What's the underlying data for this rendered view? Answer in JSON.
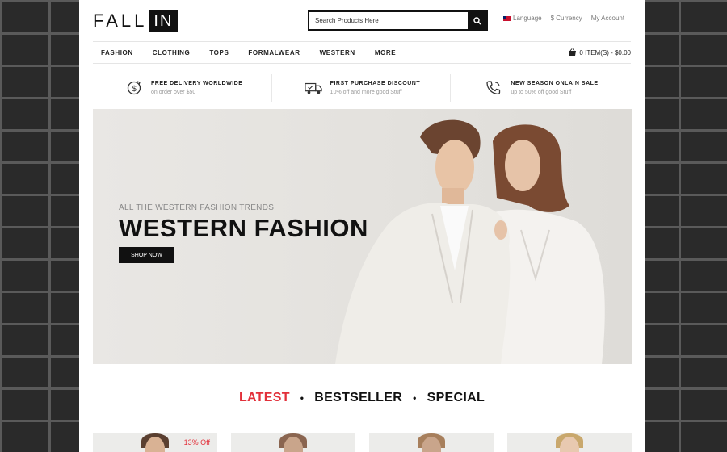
{
  "logo": {
    "part1": "FALL",
    "part2": "IN"
  },
  "search": {
    "placeholder": "Search Products Here"
  },
  "top_links": {
    "language": "Language",
    "currency": "$ Currency",
    "account": "My Account"
  },
  "nav": {
    "items": [
      "FASHION",
      "CLOTHING",
      "TOPS",
      "FORMALWEAR",
      "WESTERN",
      "MORE"
    ]
  },
  "cart": {
    "label": "0 ITEM(S) - $0.00"
  },
  "features": [
    {
      "title": "FREE DELIVERY WORLDWIDE",
      "subtitle": "on order over $50",
      "icon": "dollar-icon"
    },
    {
      "title": "FIRST PURCHASE DISCOUNT",
      "subtitle": "10% off and more good Stuff",
      "icon": "truck-icon"
    },
    {
      "title": "NEW SEASON ONLAIN SALE",
      "subtitle": "up to 50% off good Stuff",
      "icon": "phone-icon"
    }
  ],
  "banner": {
    "small": "ALL THE WESTERN FASHION TRENDS",
    "title": "WESTERN FASHION",
    "button": "SHOP NOW"
  },
  "tabs": {
    "latest": "LATEST",
    "bestseller": "BESTSELLER",
    "special": "SPECIAL"
  },
  "products": {
    "sale_badge": "13% Off"
  },
  "colors": {
    "accent": "#e2303a",
    "dark": "#111111"
  }
}
